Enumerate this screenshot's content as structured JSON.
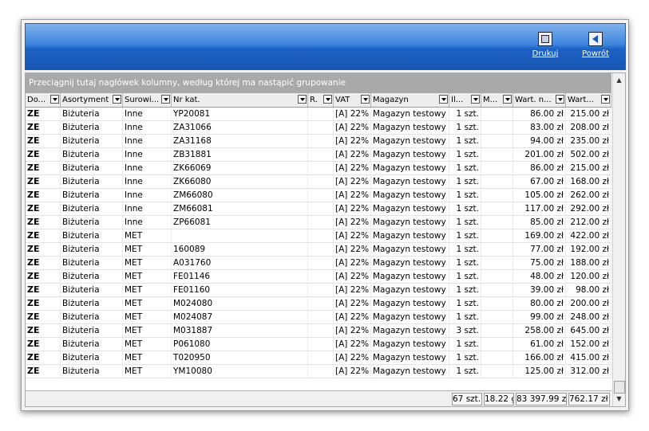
{
  "toolbar": {
    "print_label": "Drukuj",
    "back_label": "Powrót"
  },
  "grid": {
    "group_hint": "Przeciągnij tutaj nagłówek kolumny, według której ma nastąpić grupowanie",
    "columns": [
      "Do...",
      "Asortyment",
      "Surowi...",
      "Nr kat.",
      "R.",
      "VAT",
      "Magazyn",
      "Il...",
      "M...",
      "Wart. n...",
      "Wart..."
    ],
    "rows": [
      [
        "ZE",
        "Biżuteria",
        "Inne",
        "YP20081",
        "",
        "[A] 22%",
        "Magazyn testowy",
        "1 szt.",
        "",
        "86.00 zł",
        "215.00 zł"
      ],
      [
        "ZE",
        "Biżuteria",
        "Inne",
        "ZA31066",
        "",
        "[A] 22%",
        "Magazyn testowy",
        "1 szt.",
        "",
        "83.00 zł",
        "208.00 zł"
      ],
      [
        "ZE",
        "Biżuteria",
        "Inne",
        "ZA31168",
        "",
        "[A] 22%",
        "Magazyn testowy",
        "1 szt.",
        "",
        "94.00 zł",
        "235.00 zł"
      ],
      [
        "ZE",
        "Biżuteria",
        "Inne",
        "ZB31881",
        "",
        "[A] 22%",
        "Magazyn testowy",
        "1 szt.",
        "",
        "201.00 zł",
        "502.00 zł"
      ],
      [
        "ZE",
        "Biżuteria",
        "Inne",
        "ZK66069",
        "",
        "[A] 22%",
        "Magazyn testowy",
        "1 szt.",
        "",
        "86.00 zł",
        "215.00 zł"
      ],
      [
        "ZE",
        "Biżuteria",
        "Inne",
        "ZK66080",
        "",
        "[A] 22%",
        "Magazyn testowy",
        "1 szt.",
        "",
        "67.00 zł",
        "168.00 zł"
      ],
      [
        "ZE",
        "Biżuteria",
        "Inne",
        "ZM66080",
        "",
        "[A] 22%",
        "Magazyn testowy",
        "1 szt.",
        "",
        "105.00 zł",
        "262.00 zł"
      ],
      [
        "ZE",
        "Biżuteria",
        "Inne",
        "ZM66081",
        "",
        "[A] 22%",
        "Magazyn testowy",
        "1 szt.",
        "",
        "117.00 zł",
        "292.00 zł"
      ],
      [
        "ZE",
        "Biżuteria",
        "Inne",
        "ZP66081",
        "",
        "[A] 22%",
        "Magazyn testowy",
        "1 szt.",
        "",
        "85.00 zł",
        "212.00 zł"
      ],
      [
        "ZE",
        "Biżuteria",
        "MET",
        "",
        "",
        "[A] 22%",
        "Magazyn testowy",
        "1 szt.",
        "",
        "169.00 zł",
        "422.00 zł"
      ],
      [
        "ZE",
        "Biżuteria",
        "MET",
        "160089",
        "",
        "[A] 22%",
        "Magazyn testowy",
        "1 szt.",
        "",
        "77.00 zł",
        "192.00 zł"
      ],
      [
        "ZE",
        "Biżuteria",
        "MET",
        "A031760",
        "",
        "[A] 22%",
        "Magazyn testowy",
        "1 szt.",
        "",
        "75.00 zł",
        "188.00 zł"
      ],
      [
        "ZE",
        "Biżuteria",
        "MET",
        "FE01146",
        "",
        "[A] 22%",
        "Magazyn testowy",
        "1 szt.",
        "",
        "48.00 zł",
        "120.00 zł"
      ],
      [
        "ZE",
        "Biżuteria",
        "MET",
        "FE01160",
        "",
        "[A] 22%",
        "Magazyn testowy",
        "1 szt.",
        "",
        "39.00 zł",
        "98.00 zł"
      ],
      [
        "ZE",
        "Biżuteria",
        "MET",
        "M024080",
        "",
        "[A] 22%",
        "Magazyn testowy",
        "1 szt.",
        "",
        "80.00 zł",
        "200.00 zł"
      ],
      [
        "ZE",
        "Biżuteria",
        "MET",
        "M024087",
        "",
        "[A] 22%",
        "Magazyn testowy",
        "1 szt.",
        "",
        "99.00 zł",
        "248.00 zł"
      ],
      [
        "ZE",
        "Biżuteria",
        "MET",
        "M031887",
        "",
        "[A] 22%",
        "Magazyn testowy",
        "3 szt.",
        "",
        "258.00 zł",
        "645.00 zł"
      ],
      [
        "ZE",
        "Biżuteria",
        "MET",
        "P061080",
        "",
        "[A] 22%",
        "Magazyn testowy",
        "1 szt.",
        "",
        "61.00 zł",
        "152.00 zł"
      ],
      [
        "ZE",
        "Biżuteria",
        "MET",
        "T020950",
        "",
        "[A] 22%",
        "Magazyn testowy",
        "1 szt.",
        "",
        "166.00 zł",
        "415.00 zł"
      ],
      [
        "ZE",
        "Biżuteria",
        "MET",
        "YM10080",
        "",
        "[A] 22%",
        "Magazyn testowy",
        "1 szt.",
        "",
        "125.00 zł",
        "312.00 zł"
      ]
    ],
    "totals": {
      "quantity": "67 szt.",
      "weight": "18.22 g",
      "net_value": "83 397.99 zł",
      "gross_value": "762.17 zł"
    }
  }
}
